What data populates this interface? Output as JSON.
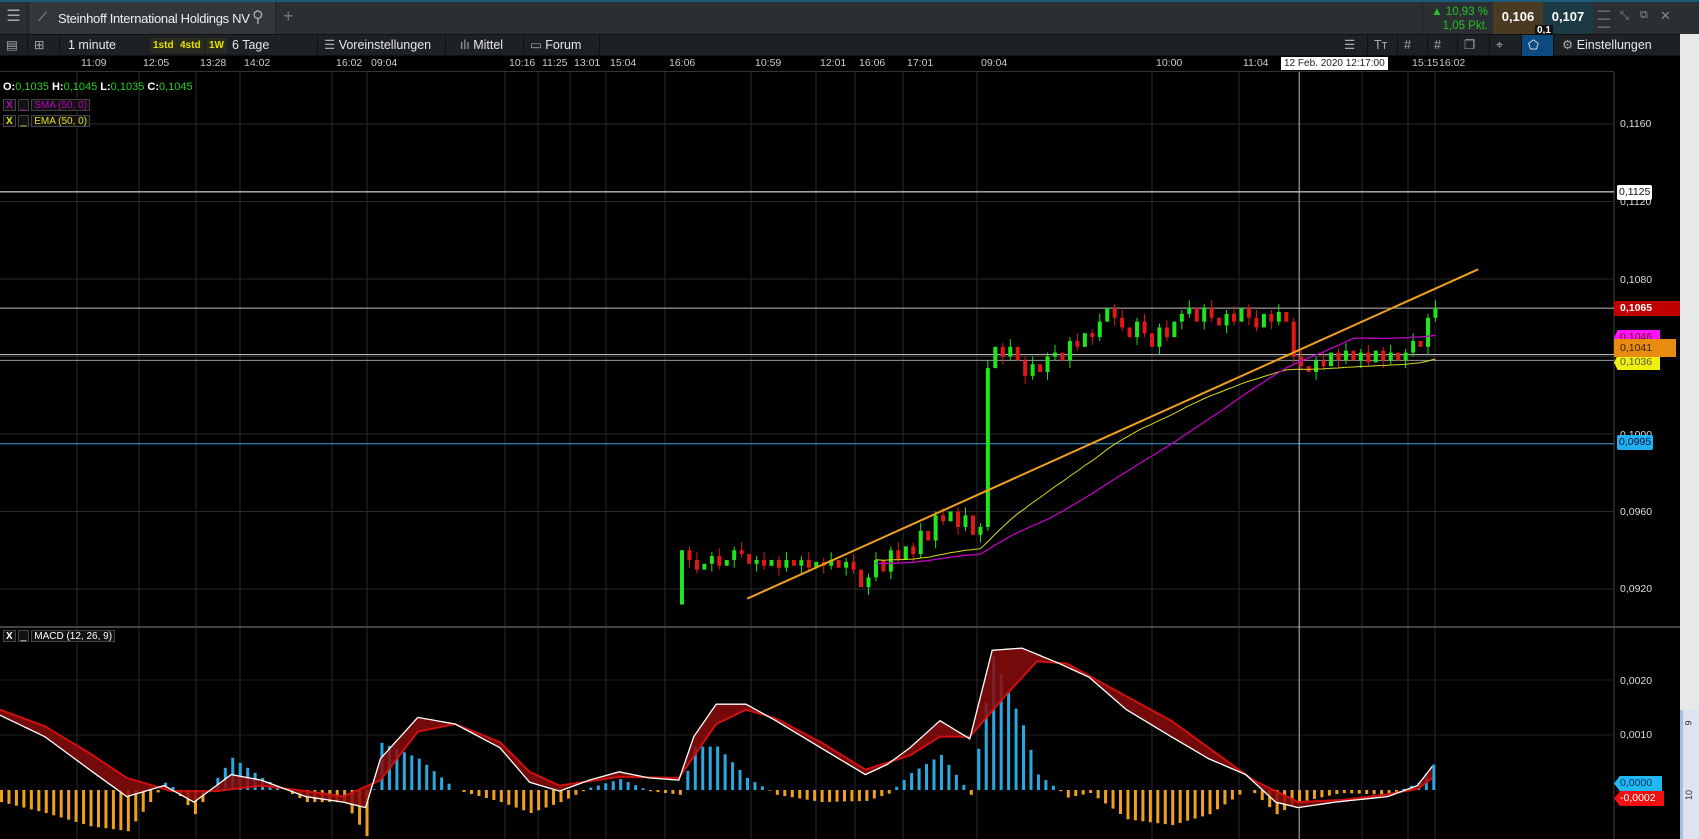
{
  "window": {
    "title": "Steinhoff International Holdings NV",
    "change_pct": "10,93 %",
    "change_pts": "1,05 Pkt.",
    "bid": "0,106",
    "ask": "0,107",
    "spread": "0,1",
    "up_color": "#22c322",
    "bid_bg": "#4a3a22",
    "ask_bg": "#1c3a46"
  },
  "toolbar": {
    "interval": "1 minute",
    "quick": [
      "1std",
      "4std",
      "1W"
    ],
    "range": "6 Tage",
    "presets": "Voreinstellungen",
    "indicator": "Mittel",
    "forum": "Forum",
    "settings": "Einstellungen"
  },
  "ohlc": {
    "o_label": "O:",
    "o": "0,1035",
    "h_label": "H:",
    "h": "0,1045",
    "l_label": "L:",
    "l": "0,1035",
    "c_label": "C:",
    "c": "0,1045"
  },
  "indicators": {
    "sma": "SMA (50, 0)",
    "ema": "EMA (50, 0)",
    "macd": "MACD (12, 26, 9)",
    "close_x": "X",
    "minimize": "_"
  },
  "crosshair": {
    "time": "12 Feb. 2020 12:17:00"
  },
  "time_labels": [
    "11:09",
    "12:05",
    "13:28",
    "14:02",
    "16:02",
    "09:04",
    "10:16",
    "11:25",
    "13:01",
    "15:04",
    "16:06",
    "10:59",
    "12:01",
    "16:06",
    "17:01",
    "09:04",
    "10:00",
    "11:04",
    "00",
    "15:15",
    "16:02"
  ],
  "price_axis": [
    "0,1160",
    "0,1120",
    "0,1080",
    "0,1000",
    "0,0960",
    "0,0920"
  ],
  "price_tags": {
    "hline_white": "0,1125",
    "last": "0,1065",
    "sma": "0,1046",
    "current": "0,1041",
    "ema": "0,1036",
    "hline_blue": "0,0995"
  },
  "macd_axis": [
    "0,0020",
    "0,0010"
  ],
  "macd_tags": {
    "macd": "0,0000",
    "signal": "-0,0002"
  },
  "right_ruler": [
    "9",
    "10"
  ],
  "chart_data": {
    "type": "candlestick",
    "price_range": [
      0.0905,
      0.117
    ],
    "hlines": [
      0.1125,
      0.1065,
      0.1041,
      0.1038,
      0.0995
    ],
    "trendline": {
      "from": [
        100,
        0.0915
      ],
      "to": [
        198,
        0.1085
      ]
    },
    "crosshair_bar": 174,
    "candles_start_bar": 91,
    "first_open": 0.0912,
    "closes": [
      0.094,
      0.0935,
      0.093,
      0.0933,
      0.0937,
      0.0932,
      0.0935,
      0.094,
      0.0938,
      0.0933,
      0.0935,
      0.0932,
      0.0935,
      0.0931,
      0.0935,
      0.0932,
      0.0935,
      0.0931,
      0.0934,
      0.0932,
      0.0935,
      0.0931,
      0.0934,
      0.093,
      0.0921,
      0.0926,
      0.0935,
      0.0929,
      0.094,
      0.0935,
      0.0942,
      0.0938,
      0.095,
      0.0945,
      0.0958,
      0.0955,
      0.096,
      0.0952,
      0.0958,
      0.0948,
      0.0952,
      0.1034,
      0.1045,
      0.104,
      0.1045,
      0.1038,
      0.103,
      0.1036,
      0.1032,
      0.104,
      0.1042,
      0.1038,
      0.1048,
      0.1045,
      0.1052,
      0.105,
      0.1058,
      0.1065,
      0.106,
      0.1055,
      0.105,
      0.1058,
      0.1052,
      0.1045,
      0.1055,
      0.105,
      0.1058,
      0.1062,
      0.1065,
      0.1058,
      0.1065,
      0.106,
      0.1056,
      0.1062,
      0.1058,
      0.1065,
      0.106,
      0.1055,
      0.1062,
      0.1058,
      0.1063,
      0.1058,
      0.104,
      0.1035,
      0.1032,
      0.1038,
      0.1035,
      0.1042,
      0.1038,
      0.1043,
      0.1038,
      0.1042,
      0.1037,
      0.1043,
      0.1038,
      0.1042,
      0.1038,
      0.1042,
      0.1048,
      0.1045,
      0.106,
      0.1065
    ],
    "macd": {
      "bars": [
        0,
        6,
        12,
        17,
        22,
        26,
        29,
        31,
        35,
        41,
        46,
        49,
        51,
        56,
        61,
        67,
        71,
        75,
        79,
        83,
        87,
        91,
        93,
        96,
        100,
        104,
        110,
        116,
        119,
        122,
        126,
        130,
        133,
        137,
        142,
        146,
        151,
        157,
        162,
        167,
        171,
        174,
        179,
        186,
        190,
        192
      ],
      "values": [
        0.00136,
        0.00097,
        0.00037,
        -0.00012,
        8e-05,
        -0.00022,
        8e-05,
        0.00028,
        0.00018,
        -0.00012,
        -0.00022,
        -0.00032,
        0.00057,
        0.00132,
        0.0012,
        0.00077,
        0.00014,
        -2e-05,
        0.00018,
        0.00033,
        0.00022,
        0.00018,
        0.00097,
        0.00156,
        0.00156,
        0.00126,
        0.00077,
        0.00028,
        0.00047,
        0.00077,
        0.00126,
        0.00093,
        0.00254,
        0.00258,
        0.0023,
        0.00205,
        0.00146,
        0.00097,
        0.00057,
        0.00028,
        -0.00022,
        -0.00032,
        -0.00022,
        -0.00012,
        8e-05,
        0.00043
      ]
    },
    "signal": {
      "bars": [
        0,
        6,
        12,
        17,
        23,
        29,
        35,
        41,
        46,
        51,
        56,
        61,
        67,
        71,
        75,
        83,
        91,
        96,
        100,
        104,
        110,
        116,
        122,
        126,
        130,
        135,
        139,
        143,
        149,
        157,
        162,
        168,
        174,
        180,
        186,
        190,
        192
      ],
      "values": [
        0.00146,
        0.00116,
        0.00067,
        0.00022,
        -2e-05,
        -2e-05,
        8e-05,
        -2e-05,
        -0.00012,
        0.00018,
        0.00106,
        0.0012,
        0.00087,
        0.00033,
        8e-05,
        0.00024,
        0.00022,
        0.0012,
        0.00146,
        0.0013,
        0.00087,
        0.00037,
        0.00063,
        0.00097,
        0.00097,
        0.00175,
        0.00234,
        0.0023,
        0.00185,
        0.00126,
        0.00077,
        0.00018,
        -0.00022,
        -0.00018,
        -8e-05,
        2e-05,
        0.00022
      ]
    },
    "macd_range": [
      -0.0009,
      0.003
    ],
    "colors": {
      "up": "#1ee51e",
      "down": "#e01818",
      "sma": "#c000c0",
      "ema": "#d8d820",
      "trend": "#f0a020",
      "macd": "#ffffff",
      "signal": "#d01010",
      "hist_pos": "#2aa8e0",
      "hist_neg": "#f0a020"
    }
  }
}
